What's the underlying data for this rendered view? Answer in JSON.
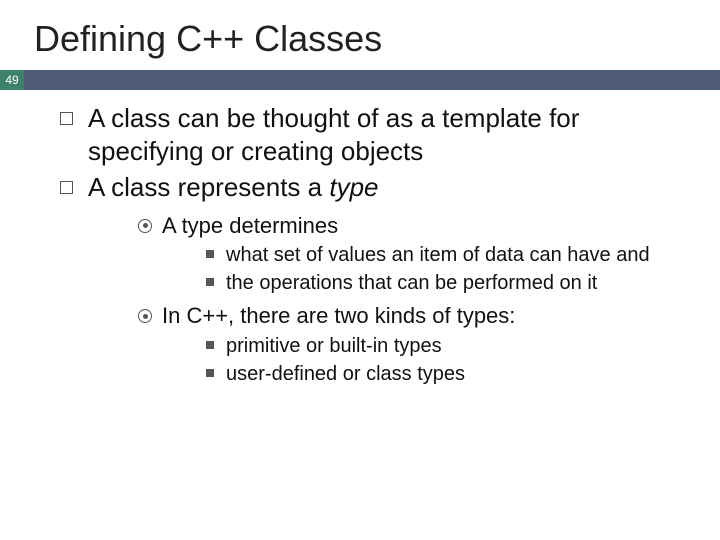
{
  "title": "Defining C++ Classes",
  "page_number": "49",
  "bullets": {
    "l1_0": "A class can be thought of as a template for specifying or creating objects",
    "l1_1_prefix": "A class represents a ",
    "l1_1_em": "type",
    "l2_0": "A type determines",
    "l3_0": "what set of values an item of data can have and",
    "l3_1": "the operations that can be performed on it",
    "l2_1": "In C++, there are two kinds of types:",
    "l3_2": "primitive or built-in types",
    "l3_3": "user-defined or class types"
  }
}
